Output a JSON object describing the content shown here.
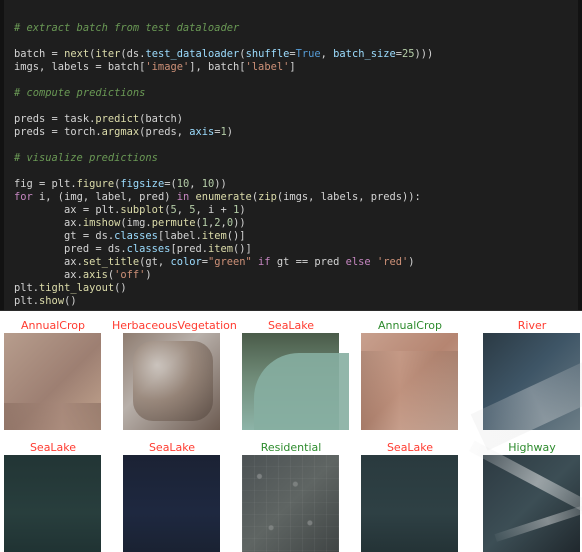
{
  "code_cell": {
    "lines": [
      {
        "tokens": [
          {
            "t": "cm",
            "v": "# extract batch from test dataloader"
          }
        ]
      },
      {
        "tokens": []
      },
      {
        "tokens": [
          {
            "t": "id",
            "v": "batch "
          },
          {
            "t": "op",
            "v": "="
          },
          {
            "t": "id",
            "v": " "
          },
          {
            "t": "fn",
            "v": "next"
          },
          {
            "t": "op",
            "v": "("
          },
          {
            "t": "fn",
            "v": "iter"
          },
          {
            "t": "op",
            "v": "("
          },
          {
            "t": "id",
            "v": "ds"
          },
          {
            "t": "op",
            "v": "."
          },
          {
            "t": "attr",
            "v": "test_dataloader"
          },
          {
            "t": "op",
            "v": "("
          },
          {
            "t": "attr",
            "v": "shuffle"
          },
          {
            "t": "op",
            "v": "="
          },
          {
            "t": "bool",
            "v": "True"
          },
          {
            "t": "op",
            "v": ", "
          },
          {
            "t": "attr",
            "v": "batch_size"
          },
          {
            "t": "op",
            "v": "="
          },
          {
            "t": "num",
            "v": "25"
          },
          {
            "t": "op",
            "v": ")))"
          }
        ]
      },
      {
        "tokens": [
          {
            "t": "id",
            "v": "imgs"
          },
          {
            "t": "op",
            "v": ", "
          },
          {
            "t": "id",
            "v": "labels "
          },
          {
            "t": "op",
            "v": "="
          },
          {
            "t": "id",
            "v": " batch"
          },
          {
            "t": "op",
            "v": "["
          },
          {
            "t": "str",
            "v": "'image'"
          },
          {
            "t": "op",
            "v": "]"
          },
          {
            "t": "op",
            "v": ", "
          },
          {
            "t": "id",
            "v": "batch"
          },
          {
            "t": "op",
            "v": "["
          },
          {
            "t": "str",
            "v": "'label'"
          },
          {
            "t": "op",
            "v": "]"
          }
        ]
      },
      {
        "tokens": []
      },
      {
        "tokens": [
          {
            "t": "cm",
            "v": "# compute predictions"
          }
        ]
      },
      {
        "tokens": []
      },
      {
        "tokens": [
          {
            "t": "id",
            "v": "preds "
          },
          {
            "t": "op",
            "v": "="
          },
          {
            "t": "id",
            "v": " task"
          },
          {
            "t": "op",
            "v": "."
          },
          {
            "t": "fn",
            "v": "predict"
          },
          {
            "t": "op",
            "v": "("
          },
          {
            "t": "id",
            "v": "batch"
          },
          {
            "t": "op",
            "v": ")"
          }
        ]
      },
      {
        "tokens": [
          {
            "t": "id",
            "v": "preds "
          },
          {
            "t": "op",
            "v": "="
          },
          {
            "t": "id",
            "v": " torch"
          },
          {
            "t": "op",
            "v": "."
          },
          {
            "t": "fn",
            "v": "argmax"
          },
          {
            "t": "op",
            "v": "("
          },
          {
            "t": "id",
            "v": "preds"
          },
          {
            "t": "op",
            "v": ", "
          },
          {
            "t": "attr",
            "v": "axis"
          },
          {
            "t": "op",
            "v": "="
          },
          {
            "t": "num",
            "v": "1"
          },
          {
            "t": "op",
            "v": ")"
          }
        ]
      },
      {
        "tokens": []
      },
      {
        "tokens": [
          {
            "t": "cm",
            "v": "# visualize predictions"
          }
        ]
      },
      {
        "tokens": []
      },
      {
        "tokens": [
          {
            "t": "id",
            "v": "fig "
          },
          {
            "t": "op",
            "v": "="
          },
          {
            "t": "id",
            "v": " plt"
          },
          {
            "t": "op",
            "v": "."
          },
          {
            "t": "fn",
            "v": "figure"
          },
          {
            "t": "op",
            "v": "("
          },
          {
            "t": "attr",
            "v": "figsize"
          },
          {
            "t": "op",
            "v": "=("
          },
          {
            "t": "num",
            "v": "10"
          },
          {
            "t": "op",
            "v": ", "
          },
          {
            "t": "num",
            "v": "10"
          },
          {
            "t": "op",
            "v": "))"
          }
        ]
      },
      {
        "tokens": [
          {
            "t": "kw",
            "v": "for"
          },
          {
            "t": "id",
            "v": " i"
          },
          {
            "t": "op",
            "v": ", ("
          },
          {
            "t": "id",
            "v": "img"
          },
          {
            "t": "op",
            "v": ", "
          },
          {
            "t": "id",
            "v": "label"
          },
          {
            "t": "op",
            "v": ", "
          },
          {
            "t": "id",
            "v": "pred"
          },
          {
            "t": "op",
            "v": ") "
          },
          {
            "t": "kw",
            "v": "in"
          },
          {
            "t": "id",
            "v": " "
          },
          {
            "t": "fn",
            "v": "enumerate"
          },
          {
            "t": "op",
            "v": "("
          },
          {
            "t": "fn",
            "v": "zip"
          },
          {
            "t": "op",
            "v": "("
          },
          {
            "t": "id",
            "v": "imgs"
          },
          {
            "t": "op",
            "v": ", "
          },
          {
            "t": "id",
            "v": "labels"
          },
          {
            "t": "op",
            "v": ", "
          },
          {
            "t": "id",
            "v": "preds"
          },
          {
            "t": "op",
            "v": ")):"
          }
        ]
      },
      {
        "tokens": [
          {
            "t": "id",
            "v": "        ax "
          },
          {
            "t": "op",
            "v": "="
          },
          {
            "t": "id",
            "v": " plt"
          },
          {
            "t": "op",
            "v": "."
          },
          {
            "t": "fn",
            "v": "subplot"
          },
          {
            "t": "op",
            "v": "("
          },
          {
            "t": "num",
            "v": "5"
          },
          {
            "t": "op",
            "v": ", "
          },
          {
            "t": "num",
            "v": "5"
          },
          {
            "t": "op",
            "v": ", "
          },
          {
            "t": "id",
            "v": "i "
          },
          {
            "t": "op",
            "v": "+"
          },
          {
            "t": "id",
            "v": " "
          },
          {
            "t": "num",
            "v": "1"
          },
          {
            "t": "op",
            "v": ")"
          }
        ]
      },
      {
        "tokens": [
          {
            "t": "id",
            "v": "        ax"
          },
          {
            "t": "op",
            "v": "."
          },
          {
            "t": "fn",
            "v": "imshow"
          },
          {
            "t": "op",
            "v": "("
          },
          {
            "t": "id",
            "v": "img"
          },
          {
            "t": "op",
            "v": "."
          },
          {
            "t": "fn",
            "v": "permute"
          },
          {
            "t": "op",
            "v": "("
          },
          {
            "t": "num",
            "v": "1"
          },
          {
            "t": "op",
            "v": ","
          },
          {
            "t": "num",
            "v": "2"
          },
          {
            "t": "op",
            "v": ","
          },
          {
            "t": "num",
            "v": "0"
          },
          {
            "t": "op",
            "v": "))"
          }
        ]
      },
      {
        "tokens": [
          {
            "t": "id",
            "v": "        gt "
          },
          {
            "t": "op",
            "v": "="
          },
          {
            "t": "id",
            "v": " ds"
          },
          {
            "t": "op",
            "v": "."
          },
          {
            "t": "attr",
            "v": "classes"
          },
          {
            "t": "op",
            "v": "["
          },
          {
            "t": "id",
            "v": "label"
          },
          {
            "t": "op",
            "v": "."
          },
          {
            "t": "fn",
            "v": "item"
          },
          {
            "t": "op",
            "v": "()]"
          }
        ]
      },
      {
        "tokens": [
          {
            "t": "id",
            "v": "        pred "
          },
          {
            "t": "op",
            "v": "="
          },
          {
            "t": "id",
            "v": " ds"
          },
          {
            "t": "op",
            "v": "."
          },
          {
            "t": "attr",
            "v": "classes"
          },
          {
            "t": "op",
            "v": "["
          },
          {
            "t": "id",
            "v": "pred"
          },
          {
            "t": "op",
            "v": "."
          },
          {
            "t": "fn",
            "v": "item"
          },
          {
            "t": "op",
            "v": "()]"
          }
        ]
      },
      {
        "tokens": [
          {
            "t": "id",
            "v": "        ax"
          },
          {
            "t": "op",
            "v": "."
          },
          {
            "t": "fn",
            "v": "set_title"
          },
          {
            "t": "op",
            "v": "("
          },
          {
            "t": "id",
            "v": "gt"
          },
          {
            "t": "op",
            "v": ", "
          },
          {
            "t": "attr",
            "v": "color"
          },
          {
            "t": "op",
            "v": "="
          },
          {
            "t": "str",
            "v": "\"green\""
          },
          {
            "t": "id",
            "v": " "
          },
          {
            "t": "kw",
            "v": "if"
          },
          {
            "t": "id",
            "v": " gt "
          },
          {
            "t": "op",
            "v": "=="
          },
          {
            "t": "id",
            "v": " pred "
          },
          {
            "t": "kw",
            "v": "else"
          },
          {
            "t": "id",
            "v": " "
          },
          {
            "t": "str",
            "v": "'red'"
          },
          {
            "t": "op",
            "v": ")"
          }
        ]
      },
      {
        "tokens": [
          {
            "t": "id",
            "v": "        ax"
          },
          {
            "t": "op",
            "v": "."
          },
          {
            "t": "fn",
            "v": "axis"
          },
          {
            "t": "op",
            "v": "("
          },
          {
            "t": "str",
            "v": "'off'"
          },
          {
            "t": "op",
            "v": ")"
          }
        ]
      },
      {
        "tokens": [
          {
            "t": "id",
            "v": "plt"
          },
          {
            "t": "op",
            "v": "."
          },
          {
            "t": "fn",
            "v": "tight_layout"
          },
          {
            "t": "op",
            "v": "()"
          }
        ]
      },
      {
        "tokens": [
          {
            "t": "id",
            "v": "plt"
          },
          {
            "t": "op",
            "v": "."
          },
          {
            "t": "fn",
            "v": "show"
          },
          {
            "t": "op",
            "v": "()"
          }
        ]
      }
    ]
  },
  "output_grid": {
    "tiles": [
      {
        "title": "AnnualCrop",
        "title_color": "#ff3b30",
        "image_class": "img-annual1"
      },
      {
        "title": "HerbaceousVegetation",
        "title_color": "#ff3b30",
        "image_class": "img-herb"
      },
      {
        "title": "SeaLake",
        "title_color": "#ff3b30",
        "image_class": "img-sea1"
      },
      {
        "title": "AnnualCrop",
        "title_color": "#2e8b2e",
        "image_class": "img-annual2"
      },
      {
        "title": "River",
        "title_color": "#ff3b30",
        "image_class": "img-river"
      },
      {
        "title": "SeaLake",
        "title_color": "#ff3b30",
        "image_class": "img-sea2"
      },
      {
        "title": "SeaLake",
        "title_color": "#ff3b30",
        "image_class": "img-sea3"
      },
      {
        "title": "Residential",
        "title_color": "#2e8b2e",
        "image_class": "img-res"
      },
      {
        "title": "SeaLake",
        "title_color": "#ff3b30",
        "image_class": "img-sea4"
      },
      {
        "title": "Highway",
        "title_color": "#2e8b2e",
        "image_class": "img-highway"
      }
    ]
  }
}
